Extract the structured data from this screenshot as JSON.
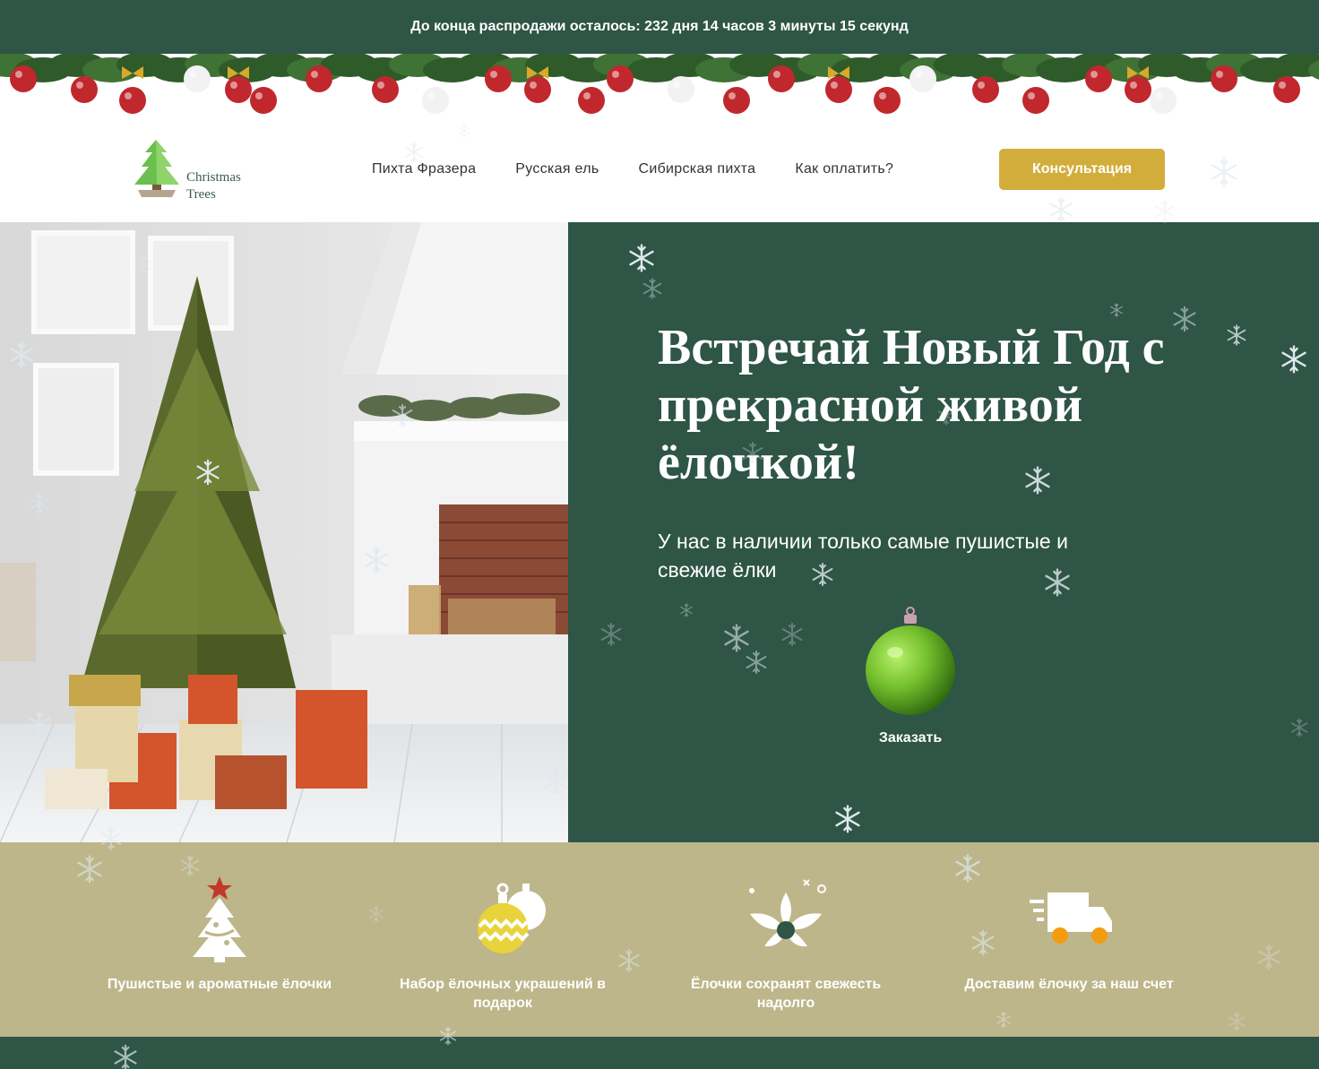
{
  "sale_bar": {
    "text": "До конца распродажи осталось: 232 дня 14 часов 3 минуты 15 секунд"
  },
  "logo": {
    "line1": "Christmas",
    "line2": "Trees",
    "icon": "christmas-tree-icon"
  },
  "nav": {
    "items": [
      "Пихта Фразера",
      "Русская ель",
      "Сибирская пихта",
      "Как оплатить?"
    ]
  },
  "header": {
    "cta_label": "Консультация"
  },
  "hero": {
    "title": "Встречай Новый Год с прекрасной живой ёлочкой!",
    "subtitle": "У нас в наличии только самые пушистые и свежие ёлки",
    "order_label": "Заказать",
    "order_icon": "christmas-ball-icon"
  },
  "features": [
    {
      "icon": "decorated-tree-icon",
      "label": "Пушистые и ароматные ёлочки"
    },
    {
      "icon": "ornaments-icon",
      "label": "Набор ёлочных украшений в подарок"
    },
    {
      "icon": "flower-icon",
      "label": "Ёлочки сохранят свежесть надолго"
    },
    {
      "icon": "delivery-truck-icon",
      "label": "Доставим ёлочку за наш счет"
    }
  ],
  "colors": {
    "dark_green": "#2e5545",
    "gold": "#d3ad3c",
    "khaki": "#bdb68a",
    "ball_green": "#7cc242"
  }
}
